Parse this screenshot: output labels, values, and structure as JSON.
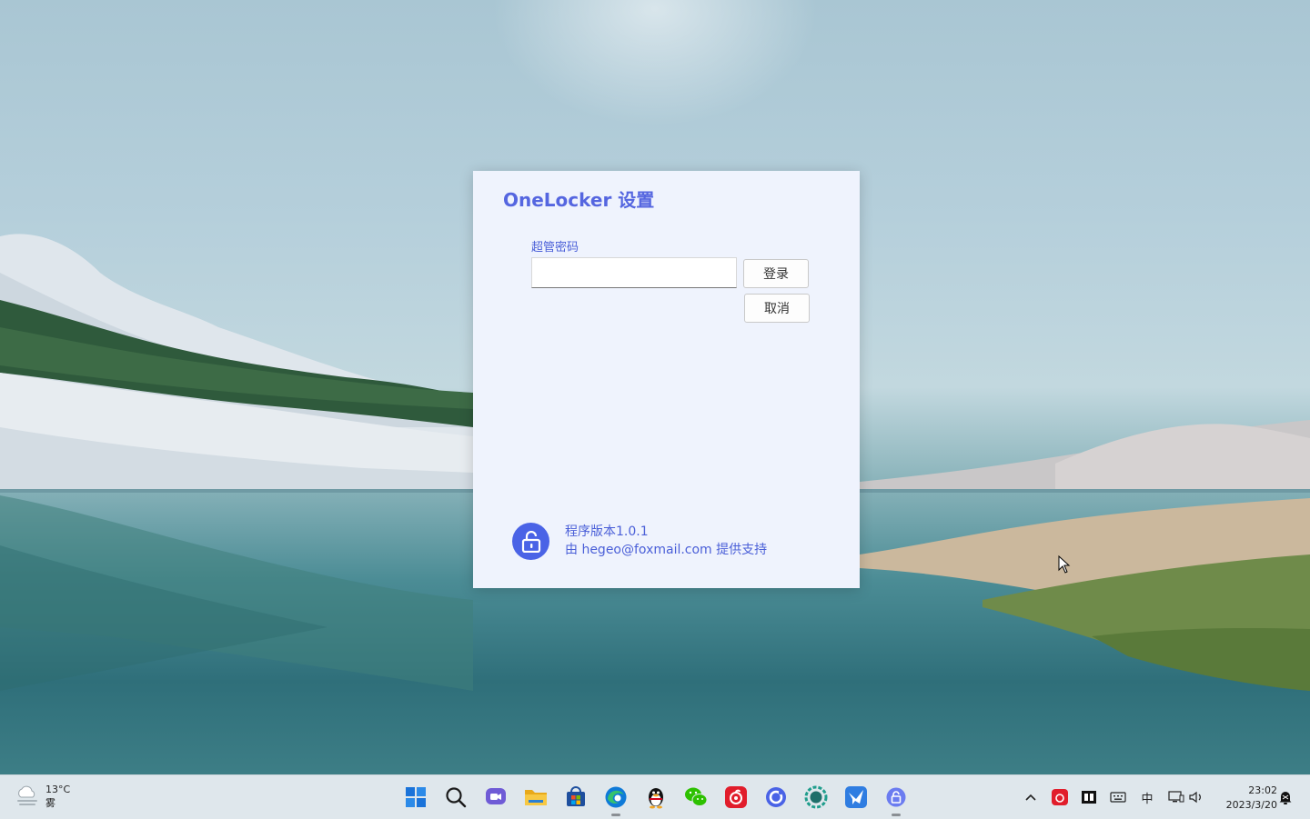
{
  "window": {
    "title": "OneLocker 设置",
    "password_label": "超管密码",
    "password_value": "",
    "login_label": "登录",
    "cancel_label": "取消",
    "version_text": "程序版本1.0.1",
    "support_text": "由 hegeo@foxmail.com 提供支持",
    "accent_color": "#5566e0",
    "background_color": "#eff3fd"
  },
  "taskbar": {
    "weather": {
      "temperature": "13°C",
      "condition": "雾",
      "icon": "cloud-fog-icon"
    },
    "apps": [
      {
        "name": "start-button",
        "icon": "windows-logo-icon"
      },
      {
        "name": "search",
        "icon": "search-icon"
      },
      {
        "name": "teams-chat",
        "icon": "video-chat-icon"
      },
      {
        "name": "file-explorer",
        "icon": "folder-icon"
      },
      {
        "name": "microsoft-store",
        "icon": "store-icon"
      },
      {
        "name": "edge",
        "icon": "edge-browser-icon",
        "running": true
      },
      {
        "name": "qq",
        "icon": "penguin-icon"
      },
      {
        "name": "wechat",
        "icon": "wechat-icon"
      },
      {
        "name": "netease-music",
        "icon": "music-icon"
      },
      {
        "name": "app-blue-ring",
        "icon": "blue-ring-icon"
      },
      {
        "name": "app-teal",
        "icon": "teal-gear-icon"
      },
      {
        "name": "app-bird",
        "icon": "bird-icon"
      },
      {
        "name": "onelocker",
        "icon": "lock-icon",
        "running": true
      }
    ],
    "tray": {
      "ime_label": "中",
      "time": "23:02",
      "date": "2023/3/20"
    }
  }
}
